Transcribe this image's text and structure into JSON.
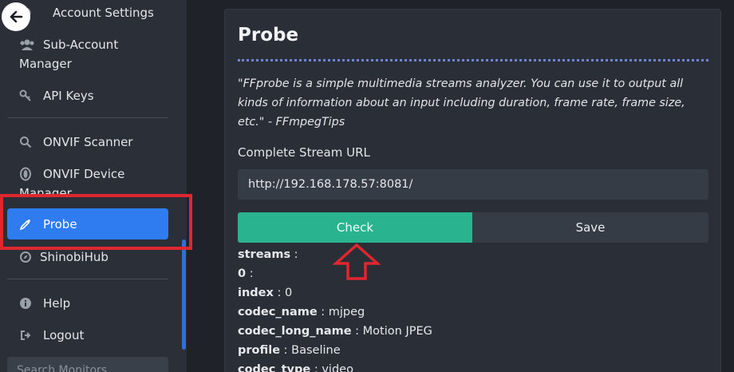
{
  "sidebar": {
    "items": [
      {
        "label": "Account Settings",
        "icon": "gear-icon"
      },
      {
        "label_line1": "Sub-Account",
        "label_line2": "Manager",
        "icon": "users-icon"
      },
      {
        "label": "API Keys",
        "icon": "key-icon"
      },
      {
        "label": "ONVIF Scanner",
        "icon": "search-icon"
      },
      {
        "label_line1": "ONVIF Device",
        "label_line2": "Manager",
        "icon": "onvif-device-icon"
      },
      {
        "label": "Probe",
        "icon": "eyedropper-icon",
        "active": true
      },
      {
        "label": "ShinobiHub",
        "icon": "compass-icon"
      },
      {
        "label": "Help",
        "icon": "info-icon"
      },
      {
        "label": "Logout",
        "icon": "logout-icon"
      }
    ],
    "search_placeholder": "Search Monitors",
    "active_color": "#2f7cf0",
    "highlight_color": "#e0262e"
  },
  "probe": {
    "title": "Probe",
    "quote": "\"FFprobe is a simple multimedia streams analyzer. You can use it to output all kinds of information about an input including duration, frame rate, frame size, etc.\" - FFmpegTips",
    "url_label": "Complete Stream URL",
    "url_value": "http://192.168.178.57:8081/",
    "check_label": "Check",
    "save_label": "Save",
    "check_color": "#29b38e",
    "results": [
      {
        "key": "streams",
        "value": ""
      },
      {
        "key": "0",
        "value": ""
      },
      {
        "key": "index",
        "value": "0"
      },
      {
        "key": "codec_name",
        "value": "mjpeg"
      },
      {
        "key": "codec_long_name",
        "value": "Motion JPEG"
      },
      {
        "key": "profile",
        "value": "Baseline"
      },
      {
        "key": "codec_type",
        "value": "video"
      }
    ]
  }
}
